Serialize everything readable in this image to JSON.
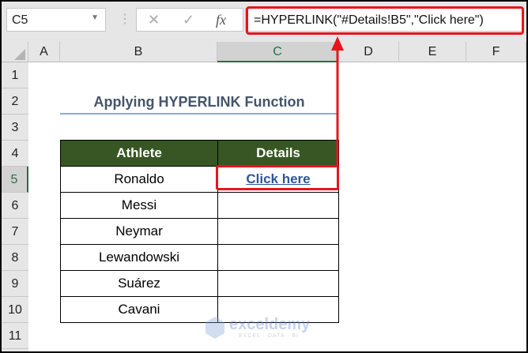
{
  "name_box": "C5",
  "formula_bar": {
    "cancel_icon": "x-icon",
    "enter_icon": "check-icon",
    "fx_label": "fx",
    "formula": "=HYPERLINK(\"#Details!B5\",\"Click here\")"
  },
  "columns": [
    "A",
    "B",
    "C",
    "D",
    "E",
    "F"
  ],
  "rows": [
    "1",
    "2",
    "3",
    "4",
    "5",
    "6",
    "7",
    "8",
    "9",
    "10",
    "11"
  ],
  "title": "Applying HYPERLINK Function",
  "table": {
    "headers": [
      "Athlete",
      "Details"
    ],
    "rows": [
      [
        "Ronaldo",
        "Click here"
      ],
      [
        "Messi",
        ""
      ],
      [
        "Neymar",
        ""
      ],
      [
        "Lewandowski",
        ""
      ],
      [
        "Suárez",
        ""
      ],
      [
        "Cavani",
        ""
      ]
    ]
  },
  "watermark": {
    "name": "exceldemy",
    "tagline": "EXCEL · DATA · BI"
  },
  "colors": {
    "header_green": "#375623",
    "highlight_red": "#e8141c",
    "link_blue": "#2f5597",
    "selection_green": "#217346"
  }
}
